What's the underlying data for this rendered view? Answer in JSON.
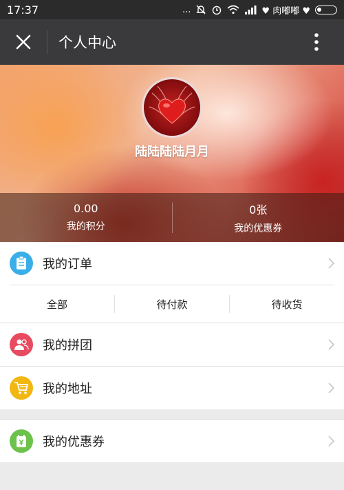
{
  "status": {
    "time": "17:37",
    "dots": "...",
    "carrier": "♥ 肉嘟嘟 ♥"
  },
  "nav": {
    "title": "个人中心"
  },
  "profile": {
    "nickname": "陆陆陆陆月月",
    "points_value": "0.00",
    "points_label": "我的积分",
    "coupons_value": "0张",
    "coupons_label": "我的优惠券"
  },
  "orders": {
    "label": "我的订单",
    "tabs": [
      "全部",
      "待付款",
      "待收货"
    ]
  },
  "menu": {
    "group_buy": "我的拼团",
    "address": "我的地址",
    "coupons": "我的优惠券"
  },
  "colors": {
    "order_icon": "#3aaee8",
    "group_icon": "#e84a5f",
    "address_icon": "#f2b713",
    "coupon_icon": "#6cc24a"
  }
}
